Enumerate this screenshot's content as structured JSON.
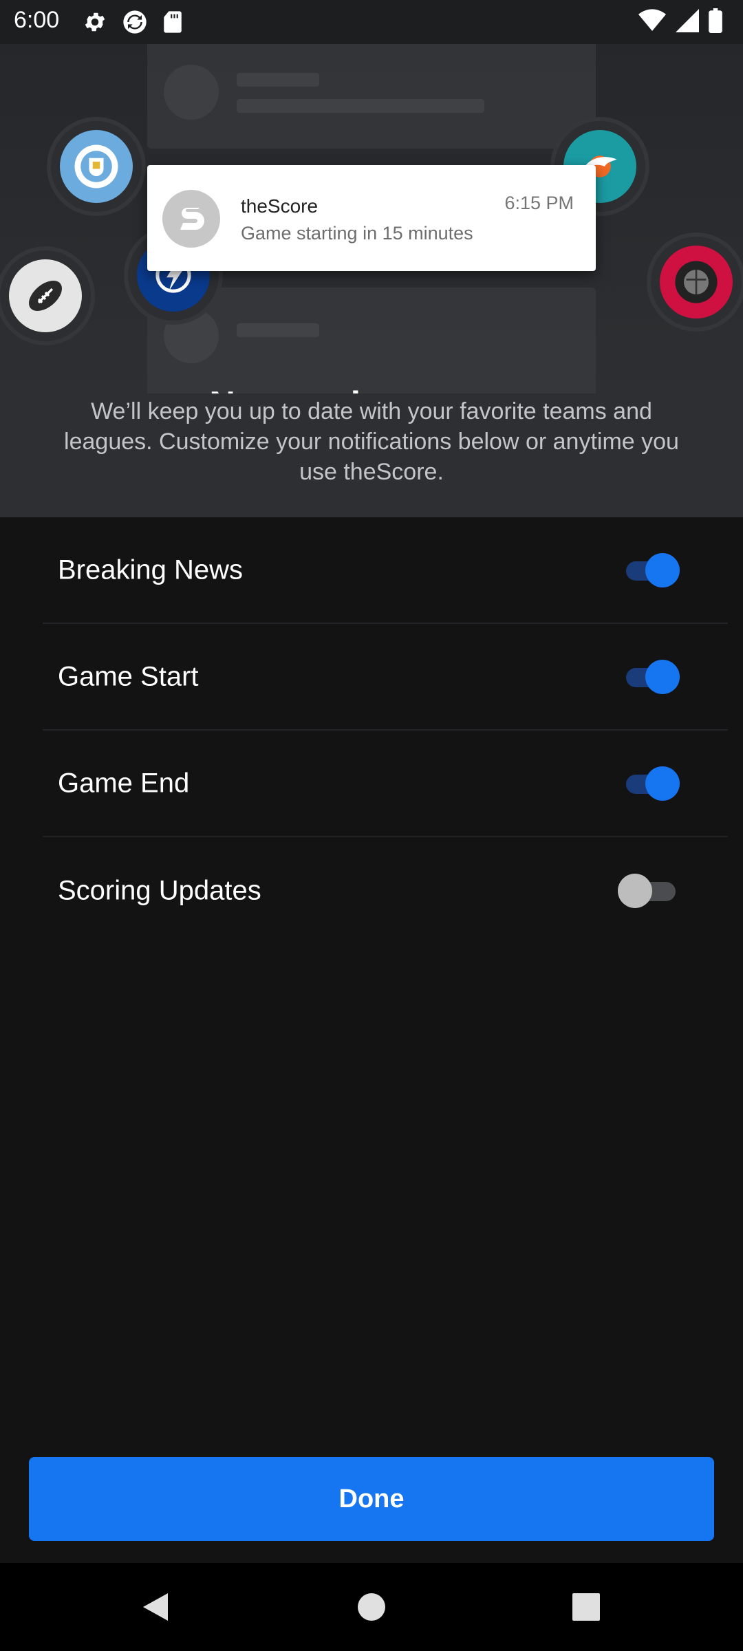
{
  "status_bar": {
    "time": "6:00",
    "left_icons": [
      "gear-icon",
      "sync-icon",
      "sd-card-icon"
    ],
    "right_icons": [
      "wifi-icon",
      "signal-icon",
      "battery-icon"
    ]
  },
  "hero": {
    "notification": {
      "app_name": "theScore",
      "message": "Game starting in 15 minutes",
      "time": "6:15 PM"
    },
    "team_logos": [
      "manchester-city-logo",
      "miami-dolphins-logo",
      "football-logo",
      "tampa-bay-lightning-logo",
      "toronto-raptors-logo"
    ],
    "title": "Never miss a game",
    "description": "We’ll keep you up to date with your favorite teams and leagues. Customize your notifications below or anytime you use theScore."
  },
  "settings": [
    {
      "label": "Breaking News",
      "enabled": true
    },
    {
      "label": "Game Start",
      "enabled": true
    },
    {
      "label": "Game End",
      "enabled": true
    },
    {
      "label": "Scoring Updates",
      "enabled": false
    }
  ],
  "done_button": {
    "label": "Done"
  },
  "colors": {
    "accent": "#1675f0",
    "background": "#131314",
    "hero_background": "#2d2f32"
  },
  "nav_bar": {
    "buttons": [
      "back-icon",
      "home-icon",
      "recents-icon"
    ]
  }
}
